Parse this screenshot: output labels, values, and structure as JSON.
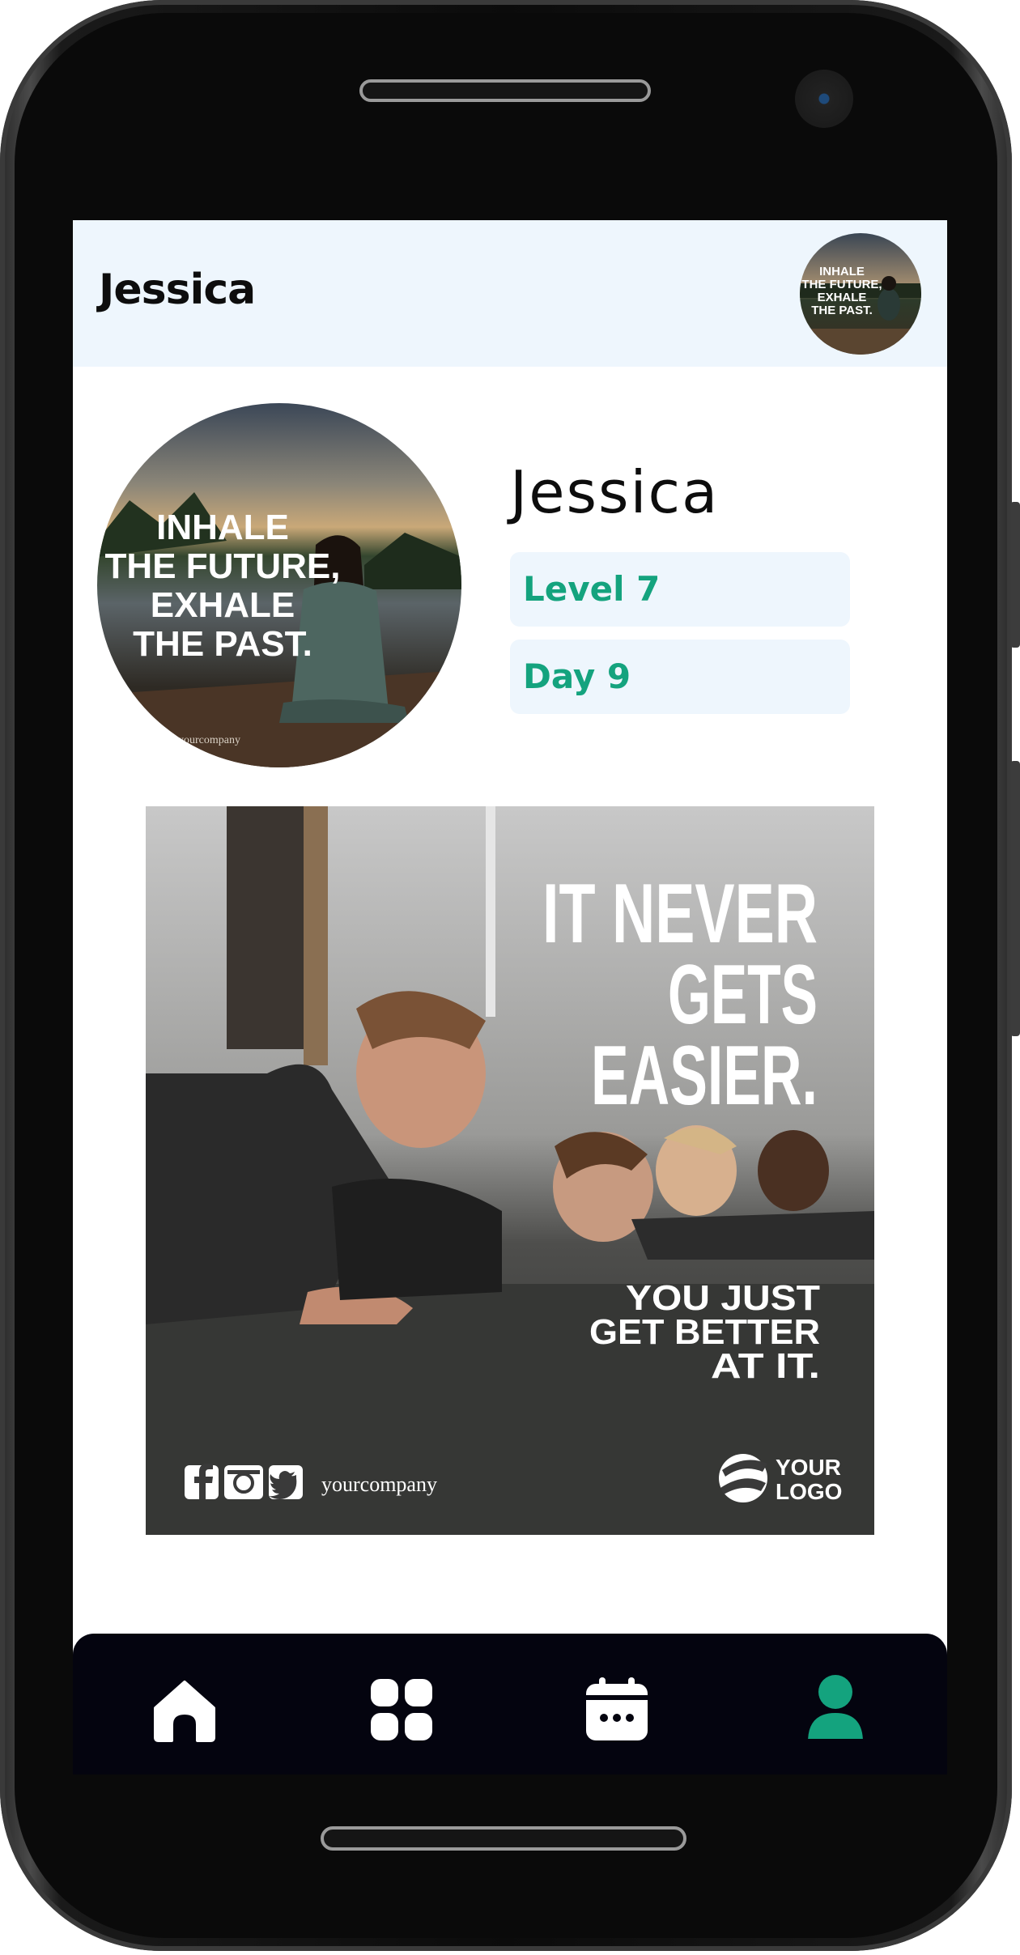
{
  "header": {
    "title": "Jessica",
    "avatar_quote": [
      "INHALE",
      "THE FUTURE,",
      "EXHALE",
      "THE PAST."
    ]
  },
  "profile": {
    "name": "Jessica",
    "level": "Level 7",
    "day": "Day 9",
    "photo_quote": [
      "INHALE",
      "THE FUTURE,",
      "EXHALE",
      "THE PAST."
    ],
    "photo_watermark": "yourcompany"
  },
  "poster": {
    "headline": [
      "IT NEVER",
      "GETS",
      "EASIER."
    ],
    "subline": [
      "YOU JUST",
      "GET BETTER",
      "AT IT."
    ],
    "handle": "yourcompany",
    "logo": [
      "YOUR",
      "LOGO"
    ],
    "social_icons": [
      "facebook-icon",
      "instagram-icon",
      "twitter-icon"
    ]
  },
  "nav": {
    "items": [
      {
        "icon": "home-icon",
        "active": false
      },
      {
        "icon": "grid-icon",
        "active": false
      },
      {
        "icon": "calendar-icon",
        "active": false
      },
      {
        "icon": "profile-icon",
        "active": true
      }
    ],
    "active_color": "#14a37e",
    "inactive_color": "#ffffff"
  },
  "colors": {
    "accent": "#14a37e",
    "header_bg": "#eef6fd",
    "nav_bg": "#04040f"
  }
}
